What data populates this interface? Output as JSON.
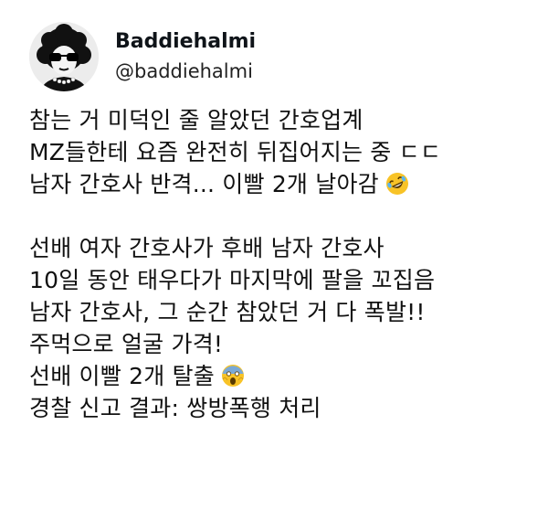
{
  "user": {
    "display_name": "Baddiehalmi",
    "handle": "@baddiehalmi"
  },
  "tweet": {
    "para1": [
      "참는 거 미덕인 줄 알았던 간호업계",
      "MZ들한테 요즘 완전히 뒤집어지는 중 ㄷㄷ",
      "남자 간호사 반격... 이빨 2개 날아감"
    ],
    "para2": [
      "선배 여자 간호사가 후배 남자 간호사",
      "10일 동안 태우다가 마지막에 팔을 꼬집음",
      "남자 간호사, 그 순간 참았던 거 다 폭발!!",
      "주먹으로 얼굴 가격!",
      "선배 이빨 2개 탈출",
      "경찰 신고 결과: 쌍방폭행 처리"
    ],
    "emoji_icons": {
      "laugh": "rolling-on-floor-laughing-emoji",
      "scream": "face-screaming-in-fear-emoji"
    }
  }
}
